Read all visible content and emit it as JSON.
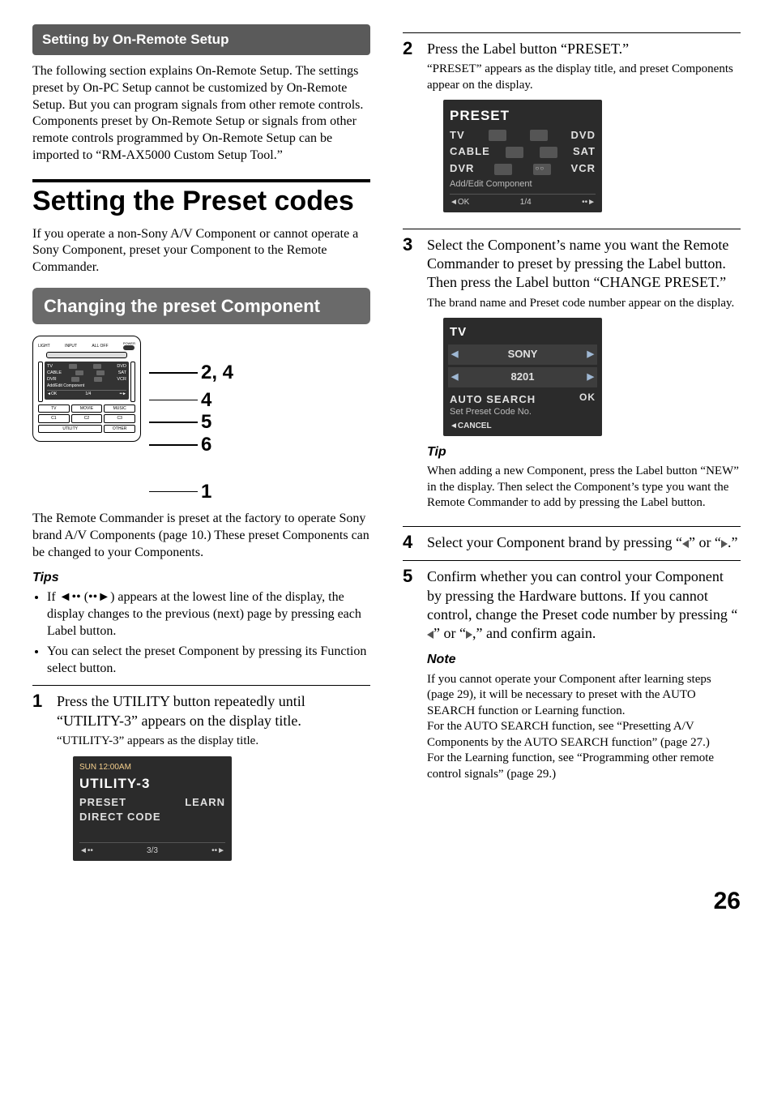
{
  "left": {
    "section_title": "Setting by On-Remote Setup",
    "intro": "The following section explains On-Remote Setup. The settings preset by On-PC Setup cannot be customized by On-Remote Setup. But you can program signals from other remote controls. Components preset by On-Remote Setup or signals from other remote controls programmed by On-Remote Setup can be imported to “RM-AX5000 Custom Setup Tool.”",
    "h1": "Setting the Preset codes",
    "para2": "If you operate a non-Sony A/V Component or cannot operate a Sony Component, preset your Component to the Remote Commander.",
    "subbar": "Changing the preset Component",
    "diagram": {
      "top_labels": [
        "LIGHT",
        "INPUT",
        "ALL OFF"
      ],
      "power_label": "POWER",
      "screen": {
        "rows": [
          [
            "TV",
            "DVD"
          ],
          [
            "CABLE",
            "SAT"
          ],
          [
            "DVR",
            "VCR"
          ]
        ],
        "add_edit": "Add/Edit Component",
        "foot_left": "◄OK",
        "foot_mid": "1/4",
        "foot_right": "••►"
      },
      "btn_rows": [
        [
          "TV",
          "MOVIE",
          "MUSIC"
        ],
        [
          "C1",
          "C2",
          "C3"
        ],
        [
          "UTILITY",
          "OTHER"
        ]
      ],
      "callouts": [
        "2, 4",
        "4",
        "5",
        "6",
        "1"
      ]
    },
    "para3": "The Remote Commander is preset at the factory to operate Sony brand A/V Components (page 10.) These preset Components can be changed to your Components.",
    "tips_h": "Tips",
    "tips": [
      "If ◄•• (••►) appears at the lowest line of the display, the display changes to the previous (next) page by pressing each Label button.",
      "You can select the preset Component by pressing its Function select button."
    ],
    "step1": {
      "num": "1",
      "lead": "Press the UTILITY button repeatedly until “UTILITY-3” appears on the display title.",
      "note": "“UTILITY-3” appears as the display title."
    },
    "lcd1": {
      "sun": "SUN 12:00AM",
      "title": "UTILITY-3",
      "rows": [
        [
          "PRESET",
          "LEARN"
        ],
        [
          "DIRECT CODE",
          ""
        ]
      ],
      "foot_left": "◄••",
      "foot_mid": "3/3",
      "foot_right": "••►"
    }
  },
  "right": {
    "step2": {
      "num": "2",
      "lead": "Press the Label button “PRESET.”",
      "note": "“PRESET” appears as the display title, and preset Components appear on the display."
    },
    "lcd2": {
      "title": "PRESET",
      "rows": [
        [
          "TV",
          "DVD"
        ],
        [
          "CABLE",
          "SAT"
        ],
        [
          "DVR",
          "VCR"
        ]
      ],
      "sub": "Add/Edit Component",
      "foot_left": "◄OK",
      "foot_mid": "1/4",
      "foot_right": "••►"
    },
    "step3": {
      "num": "3",
      "lead": "Select the Component’s name you want the Remote Commander to preset by pressing the Label button.  Then press the Label button “CHANGE PRESET.”",
      "note": "The brand name and Preset code number appear on the display."
    },
    "lcd3": {
      "title": "TV",
      "field1": "SONY",
      "field2": "8201",
      "auto": "AUTO SEARCH",
      "ok": "OK",
      "sub": "Set Preset Code No.",
      "cancel": "◄CANCEL"
    },
    "tip_h": "Tip",
    "tip_body": "When adding a new Component, press the Label button “NEW” in the display. Then select the Component’s type you want the Remote Commander to add by pressing the Label button.",
    "step4": {
      "num": "4",
      "lead_pre": " Select your Component brand by pressing “",
      "lead_mid": "” or “",
      "lead_post": ".”"
    },
    "step5": {
      "num": "5",
      "lead_pre": "Confirm whether you can control your Component by pressing the Hardware buttons. If you cannot control, change the Preset code number by pressing “",
      "lead_mid": "” or “",
      "lead_post": ",” and confirm again."
    },
    "note_h": "Note",
    "note_body": "If you cannot operate your Component after learning steps (page 29), it will be necessary to preset with the AUTO SEARCH function or Learning function.\nFor the AUTO SEARCH function, see “Presetting A/V Components by the AUTO SEARCH function” (page 27.)\nFor the Learning function, see “Programming other remote control signals” (page 29.)"
  },
  "page_number": "26"
}
